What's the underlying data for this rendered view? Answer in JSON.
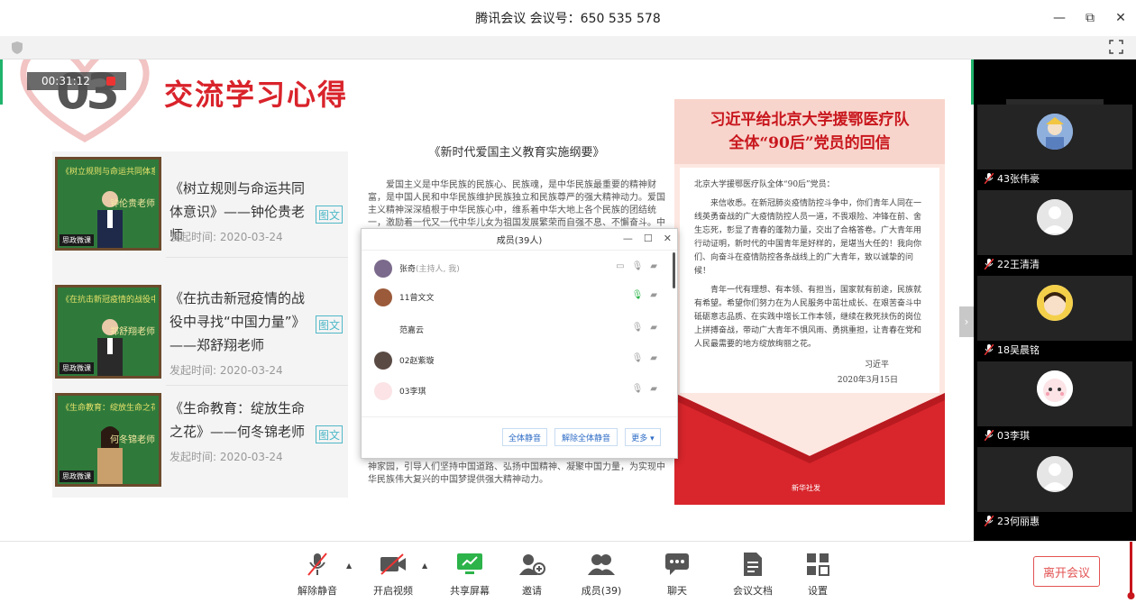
{
  "window": {
    "title": "腾讯会议  会议号：650 535 578",
    "controls": [
      "—",
      "⧉",
      "✕"
    ]
  },
  "slide": {
    "number": "03",
    "timer": "00:31:12",
    "title": "交流学习心得",
    "cards": [
      {
        "title": "《树立规则与命运共同体意识》——钟伦贵老师",
        "date": "发起时间: 2020-03-24",
        "badge": "图文",
        "chalk": "《树立规则与命运共同体意识》",
        "teacher": "钟伦贵老师",
        "tag": "思政微课"
      },
      {
        "title": "《在抗击新冠疫情的战役中寻找“中国力量”》——郑舒翔老师",
        "date": "发起时间: 2020-03-24",
        "badge": "图文",
        "chalk": "《在抗击新冠疫情的战役中寻找“中国力量”》",
        "teacher": "郑舒翔老师",
        "tag": "思政微课"
      },
      {
        "title": "《生命教育：绽放生命之花》——何冬锦老师",
        "date": "发起时间: 2020-03-24",
        "badge": "图文",
        "chalk": "《生命教育：绽放生命之花》",
        "teacher": "何冬锦老师",
        "tag": "思政微课"
      }
    ],
    "doc": {
      "title": "《新时代爱国主义教育实施纲要》",
      "para1": "爱国主义是中华民族的民族心、民族魂，是中华民族最重要的精神财富，是中国人民和中华民族维护民族独立和民族尊严的强大精神动力。爱国主义精神深深植根于中华民族心中，维系着中华大地上各个民族的团结统一，激励着一代又一代中华儿女为祖国发展繁荣而自强不息、不懈奋斗。中国共产党是爱国主义精",
      "para2": "追求，着力凝聚全国各族人民团结奋斗的精神纽带，厚植家国情怀，培育精神家园，引导人们坚持中国道路、弘扬中国精神、凝聚中国力量，为实现中华民族伟大复兴的中国梦提供强大精神动力。"
    },
    "letter": {
      "title1": "习近平给北京大学援鄂医疗队",
      "title2": "全体“90后”党员的回信",
      "salutation": "北京大学援鄂医疗队全体“90后”党员：",
      "p1": "来信收悉。在新冠肺炎疫情防控斗争中，你们青年人同在一线英勇奋战的广大疫情防控人员一道，不畏艰险、冲锋在前、舍生忘死，彰显了青春的蓬勃力量，交出了合格答卷。广大青年用行动证明，新时代的中国青年是好样的，是堪当大任的！我向你们、向奋斗在疫情防控各条战线上的广大青年，致以诚挚的问候！",
      "p2": "青年一代有理想、有本领、有担当，国家就有前途，民族就有希望。希望你们努力在为人民服务中茁壮成长、在艰苦奋斗中砥砺意志品质、在实践中增长工作本领，继续在救死扶伤的岗位上拼搏奋战，带动广大青年不惧风雨、勇挑重担，让青春在党和人民最需要的地方绽放绚丽之花。",
      "signer": "习近平",
      "date": "2020年3月15日",
      "logo": "新华社发"
    }
  },
  "members": {
    "title": "成员(39人)",
    "rows": [
      {
        "name": "张奇",
        "note": "(主持人, 我)"
      },
      {
        "name": "11曾文文",
        "note": ""
      },
      {
        "name": "范嘉云",
        "note": ""
      },
      {
        "name": "02赵紫璇",
        "note": ""
      },
      {
        "name": "03李琪",
        "note": ""
      }
    ],
    "buttons": {
      "mute_all": "全体静音",
      "unmute_all": "解除全体静音",
      "more": "更多 ▾"
    }
  },
  "participants": [
    {
      "name": "43张伟豪"
    },
    {
      "name": "22王清清"
    },
    {
      "name": "18吴晨铭"
    },
    {
      "name": "03李琪"
    },
    {
      "name": "23何丽惠"
    }
  ],
  "toolbar": {
    "unmute": "解除静音",
    "video": "开启视频",
    "share": "共享屏幕",
    "invite": "邀请",
    "members": "成员(39)",
    "chat": "聊天",
    "docs": "会议文档",
    "settings": "设置",
    "leave": "离开会议"
  },
  "colors": {
    "accent_red": "#d9232b",
    "green": "#2cb34a",
    "link_blue": "#2e6cc6"
  }
}
